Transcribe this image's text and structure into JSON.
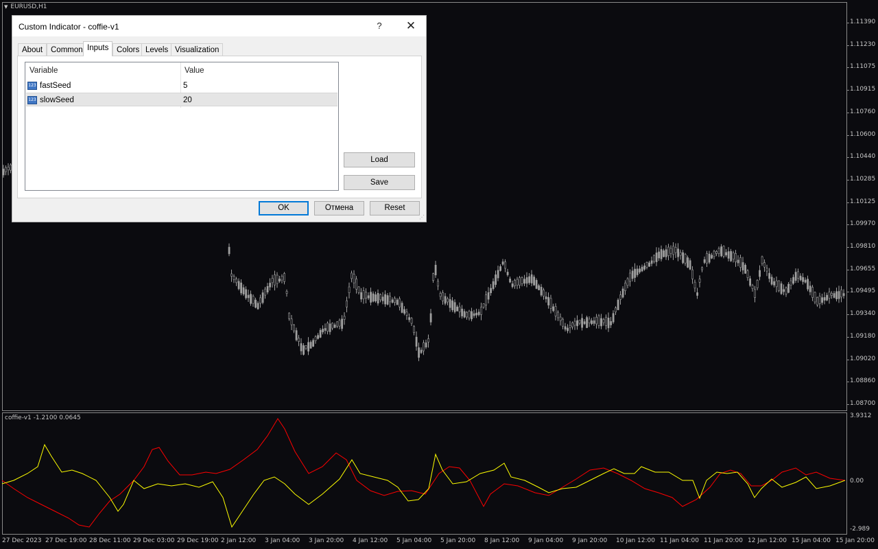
{
  "colors": {
    "background": "#0b0b0f",
    "candle": "#a0a0a0",
    "fast_line": "#ffff00",
    "slow_line": "#ff0000",
    "axis_text": "#c8c8c8",
    "dialog_bg": "#f0f0f0",
    "accent": "#0078d7"
  },
  "chart": {
    "symbol": "EURUSD,H1",
    "indicator_label": "coffie-v1 -1.2100 0.0645",
    "price_axis": [
      "1.11390",
      "1.11230",
      "1.11075",
      "1.10915",
      "1.10760",
      "1.10600",
      "1.10440",
      "1.10285",
      "1.10125",
      "1.09970",
      "1.09810",
      "1.09655",
      "1.09495",
      "1.09340",
      "1.09180",
      "1.09020",
      "1.08860",
      "1.08700"
    ],
    "indicator_axis": [
      "3.9312",
      "0.00",
      "-2.989"
    ],
    "time_axis": [
      "27 Dec 2023",
      "27 Dec 19:00",
      "28 Dec 11:00",
      "29 Dec 03:00",
      "29 Dec 19:00",
      "2 Jan 12:00",
      "3 Jan 04:00",
      "3 Jan 20:00",
      "4 Jan 12:00",
      "5 Jan 04:00",
      "5 Jan 20:00",
      "8 Jan 12:00",
      "9 Jan 04:00",
      "9 Jan 20:00",
      "10 Jan 12:00",
      "11 Jan 04:00",
      "11 Jan 20:00",
      "12 Jan 12:00",
      "15 Jan 04:00",
      "15 Jan 20:00"
    ]
  },
  "chart_data": {
    "type": "line",
    "series": [
      {
        "name": "fastSeed",
        "color": "#ffff00"
      },
      {
        "name": "slowSeed",
        "color": "#ff0000"
      }
    ]
  },
  "dialog": {
    "title": "Custom Indicator - coffie-v1",
    "help": "?",
    "close": "✕",
    "tabs": [
      "About",
      "Common",
      "Inputs",
      "Colors",
      "Levels",
      "Visualization"
    ],
    "active_tab": "Inputs",
    "table": {
      "headers": {
        "variable": "Variable",
        "value": "Value"
      },
      "rows": [
        {
          "icon": "123",
          "name": "fastSeed",
          "value": "5"
        },
        {
          "icon": "123",
          "name": "slowSeed",
          "value": "20"
        }
      ]
    },
    "buttons": {
      "load": "Load",
      "save": "Save",
      "ok": "OK",
      "cancel": "Отмена",
      "reset": "Reset"
    }
  }
}
